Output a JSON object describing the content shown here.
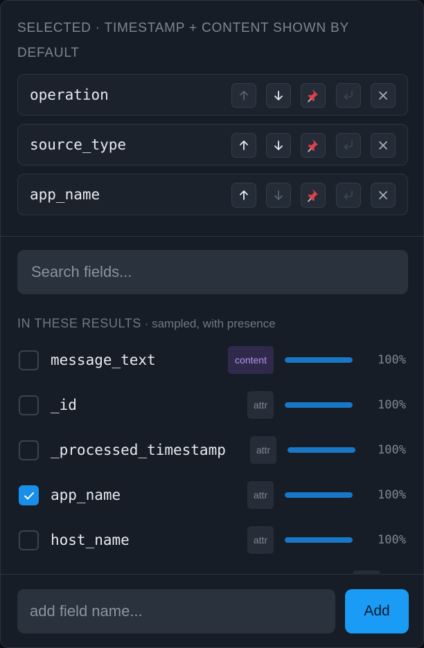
{
  "selected": {
    "title": "SELECTED · TIMESTAMP + CONTENT SHOWN BY DEFAULT",
    "rows": [
      {
        "name": "operation",
        "up_enabled": false,
        "down_enabled": true
      },
      {
        "name": "source_type",
        "up_enabled": true,
        "down_enabled": true
      },
      {
        "name": "app_name",
        "up_enabled": true,
        "down_enabled": false
      }
    ],
    "button_icons": [
      "arrow-up-icon",
      "arrow-down-icon",
      "pin-icon",
      "return-icon",
      "close-icon"
    ]
  },
  "search": {
    "placeholder": "Search fields..."
  },
  "results": {
    "heading": "IN THESE RESULTS",
    "subheading": " · sampled, with presence",
    "fields": [
      {
        "name": "message_text",
        "badge": "content",
        "presence": 1.0,
        "percent": "100%",
        "checked": false
      },
      {
        "name": "_id",
        "badge": "attr",
        "presence": 1.0,
        "percent": "100%",
        "checked": false
      },
      {
        "name": "_processed_timestamp",
        "badge": "attr",
        "presence": 1.0,
        "percent": "100%",
        "checked": false
      },
      {
        "name": "app_name",
        "badge": "attr",
        "presence": 1.0,
        "percent": "100%",
        "checked": true
      },
      {
        "name": "host_name",
        "badge": "attr",
        "presence": 1.0,
        "percent": "100%",
        "checked": false
      }
    ]
  },
  "footer": {
    "placeholder": "add field name...",
    "add_label": "Add"
  },
  "colors": {
    "accent": "#1a9bf5",
    "bar": "#1877c7",
    "pin": "#e0404a",
    "content_badge": "#b592f0"
  }
}
